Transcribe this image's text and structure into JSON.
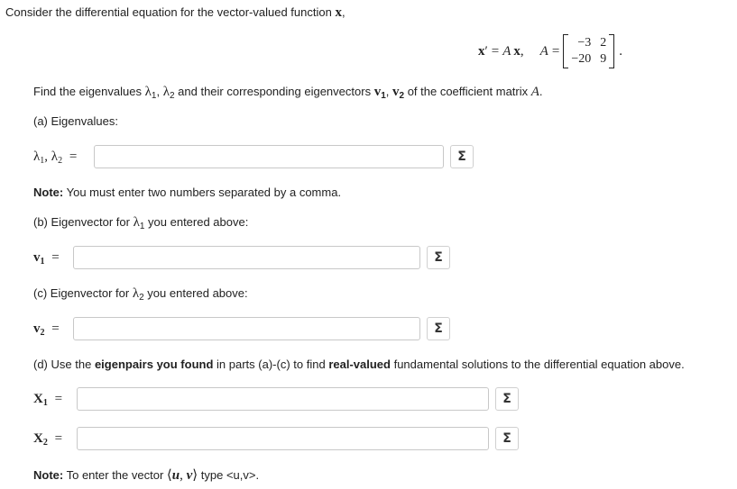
{
  "intro": {
    "text": "Consider the differential equation for the vector-valued function",
    "var": "x",
    "end": ","
  },
  "equation": {
    "lhs_var": "x",
    "prime": "′",
    "eq": "=",
    "rhs_A": "A",
    "rhs_x": "x",
    "comma": ",",
    "A_label": "A",
    "A_eq": "=",
    "matrix": {
      "r1c1": "−3",
      "r1c2": "2",
      "r2c1": "−20",
      "r2c2": "9"
    },
    "period": "."
  },
  "find": {
    "pre": "Find the eigenvalues",
    "lam": "λ",
    "sub1": "1",
    "comma1": ", ",
    "lam2": "λ",
    "sub2": "2",
    "mid": "and their corresponding eigenvectors",
    "v": "v",
    "vsub1": "1",
    "comma2": ", ",
    "v2": "v",
    "vsub2": "2",
    "post": "of the coefficient matrix",
    "A": "A",
    "end": "."
  },
  "part_a": {
    "label": "(a) Eigenvalues:",
    "lhs_lam1": "λ",
    "lhs_sub1": "1",
    "lhs_comma": ", ",
    "lhs_lam2": "λ",
    "lhs_sub2": "2",
    "eq": "=",
    "input_value": ""
  },
  "note1": {
    "bold": "Note:",
    "text": "You must enter two numbers separated by a comma."
  },
  "part_b": {
    "pre": "(b) Eigenvector for",
    "lam": "λ",
    "sub": "1",
    "post": "you entered above:",
    "lhs_v": "v",
    "lhs_sub": "1",
    "eq": "=",
    "input_value": ""
  },
  "part_c": {
    "pre": "(c) Eigenvector for",
    "lam": "λ",
    "sub": "2",
    "post": "you entered above:",
    "lhs_v": "v",
    "lhs_sub": "2",
    "eq": "=",
    "input_value": ""
  },
  "part_d": {
    "pre": "(d) Use the",
    "bold1": "eigenpairs you found",
    "mid": "in parts (a)-(c) to find",
    "bold2": "real-valued",
    "post": "fundamental solutions to the differential equation above.",
    "x1_lhs": "X",
    "x1_sub": "1",
    "x2_lhs": "X",
    "x2_sub": "2",
    "eq": "=",
    "x1_value": "",
    "x2_value": ""
  },
  "note2": {
    "bold": "Note:",
    "pre": "To enter the vector",
    "vec_open": "⟨",
    "u": "u",
    "sep": ", ",
    "v": "v",
    "vec_close": "⟩",
    "post": "type <u,v>."
  },
  "sigma_icon": "Σ"
}
